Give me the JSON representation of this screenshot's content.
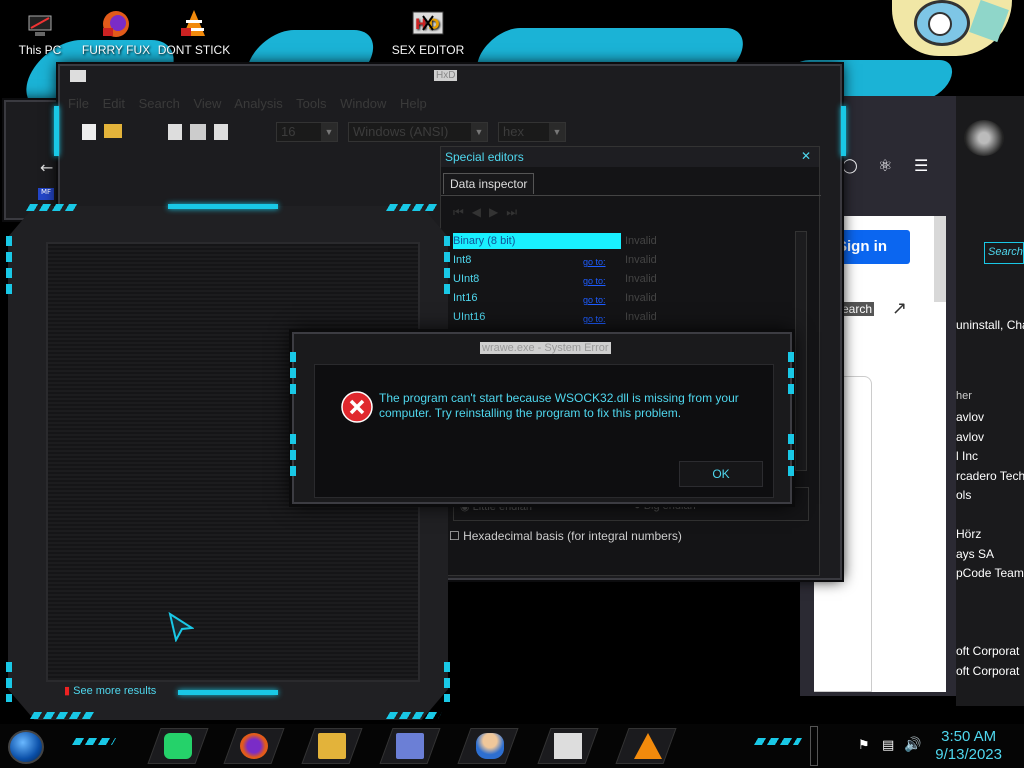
{
  "desktop": {
    "icons": [
      {
        "label": "This PC",
        "icon": "computer-icon"
      },
      {
        "label": "FURRY FUX",
        "icon": "firefox-icon"
      },
      {
        "label": "DONT STICK",
        "icon": "vlc-icon"
      },
      {
        "label": "SEX EDITOR",
        "icon": "hxd-icon"
      }
    ]
  },
  "hxd": {
    "title": "HxD",
    "menu": [
      "File",
      "Edit",
      "Search",
      "View",
      "Analysis",
      "Tools",
      "Window",
      "Help"
    ],
    "toolbar": {
      "bytes_per_row": "16",
      "charset": "Windows (ANSI)",
      "offset_base": "hex"
    },
    "special_editors": {
      "title": "Special editors",
      "tab": "Data inspector",
      "rows": [
        {
          "label": "Binary (8 bit)",
          "link": "",
          "value": "Invalid"
        },
        {
          "label": "Int8",
          "link": "go to:",
          "value": "Invalid"
        },
        {
          "label": "UInt8",
          "link": "go to:",
          "value": "Invalid"
        },
        {
          "label": "Int16",
          "link": "go to:",
          "value": "Invalid"
        },
        {
          "label": "UInt16",
          "link": "go to:",
          "value": "Invalid"
        }
      ],
      "little_endian": "Little endian",
      "big_endian": "Big endian",
      "hex_basis": "Hexadecimal basis (for integral numbers)"
    }
  },
  "firefox": {
    "sign_in": "Sign in",
    "search_label": "Search"
  },
  "right_list": {
    "search_placeholder": "Search",
    "header_text": "uninstall, Cha",
    "publisher_header": "her",
    "items": [
      "avlov",
      "avlov",
      "l Inc",
      "rcadero Techn",
      "ols",
      "",
      "Hörz",
      "ays SA",
      "pCode Team",
      "",
      "",
      "",
      "oft Corporat",
      "oft Corporat"
    ]
  },
  "panel": {
    "see_more": "See more results"
  },
  "dialog": {
    "title": "wrawe.exe - System Error",
    "message": "The program can't start because WSOCK32.dll is missing from your computer. Try reinstalling the program to fix this problem.",
    "ok_label": "OK"
  },
  "taskbar": {
    "apps": [
      "start-orb-icon",
      "spotify-icon",
      "firefox-icon",
      "file-explorer-icon",
      "control-panel-icon",
      "user-icon",
      "hxd-icon",
      "vlc-icon"
    ],
    "time": "3:50 AM",
    "date": "9/13/2023"
  },
  "colors": {
    "accent": "#19c8e6",
    "text_accent": "#4fd7ee",
    "error_red": "#e0282e"
  }
}
